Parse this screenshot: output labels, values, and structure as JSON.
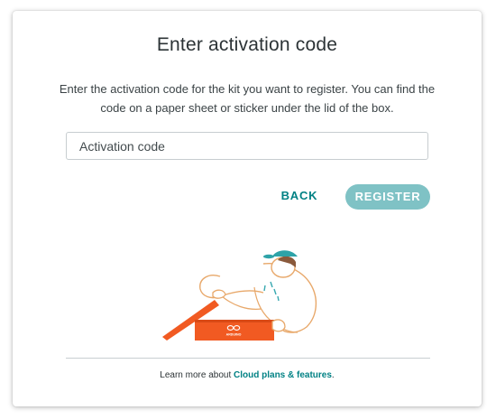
{
  "dialog": {
    "title": "Enter activation code",
    "description": "Enter the activation code for the kit you want to register. You can find the code on a paper sheet or sticker under the lid of the box."
  },
  "activation_input": {
    "placeholder": "Activation code",
    "value": ""
  },
  "buttons": {
    "back_label": "BACK",
    "register_label": "REGISTER"
  },
  "illustration": {
    "box_logo_text": "ARDUINO",
    "icon": "person-opening-box-illustration"
  },
  "footer": {
    "text_prefix": "Learn more about ",
    "link_label": "Cloud plans & features",
    "text_suffix": "."
  },
  "colors": {
    "accent": "#008184",
    "register_button_bg": "#7fc2c5",
    "box_orange": "#f15a22",
    "title_text": "#2c3336"
  }
}
